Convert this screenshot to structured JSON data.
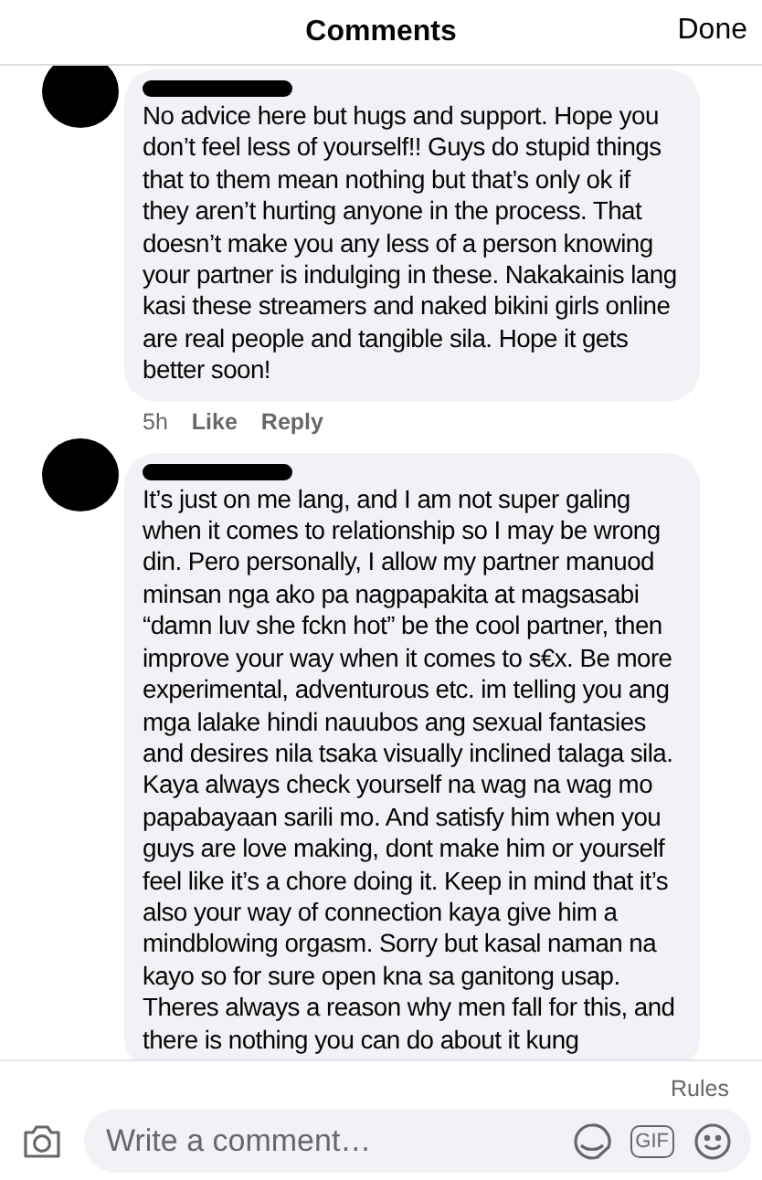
{
  "header": {
    "title": "Comments",
    "done": "Done"
  },
  "comments": [
    {
      "text": "No advice here but hugs and support. Hope you don’t feel less of yourself!! Guys do stupid things that to them mean nothing but that’s only ok if they aren’t hurting anyone in the process. That doesn’t make you any less of a person knowing your partner is indulging in these. Nakakainis lang kasi these streamers and naked bikini girls online are real people and tangible sila. Hope it gets better soon!",
      "time": "5h",
      "like": "Like",
      "reply": "Reply"
    },
    {
      "text": "It’s just on me lang, and I am not super galing when it comes to relationship so I may be wrong din. Pero personally, I allow my partner manuod minsan nga ako pa nagpapakita at magsasabi “damn luv she fckn hot” be the cool partner, then improve your way when it comes to s€x. Be more experimental, adventurous etc. im telling you ang mga lalake hindi nauubos ang sexual fantasies and desires nila tsaka visually inclined talaga sila. Kaya always check yourself na wag na wag mo papabayaan sarili mo. And satisfy him when you guys are love making, dont make him or yourself feel like it’s a chore doing it. Keep in mind that it’s also your way of connection kaya give him a mindblowing orgasm. Sorry but kasal naman na kayo so for sure open kna sa ganitong usap. Theres always a reason why men fall for this, and there is nothing you can do about it kung"
    }
  ],
  "rules": "Rules",
  "composer": {
    "placeholder": "Write a comment…",
    "gif": "GIF"
  }
}
